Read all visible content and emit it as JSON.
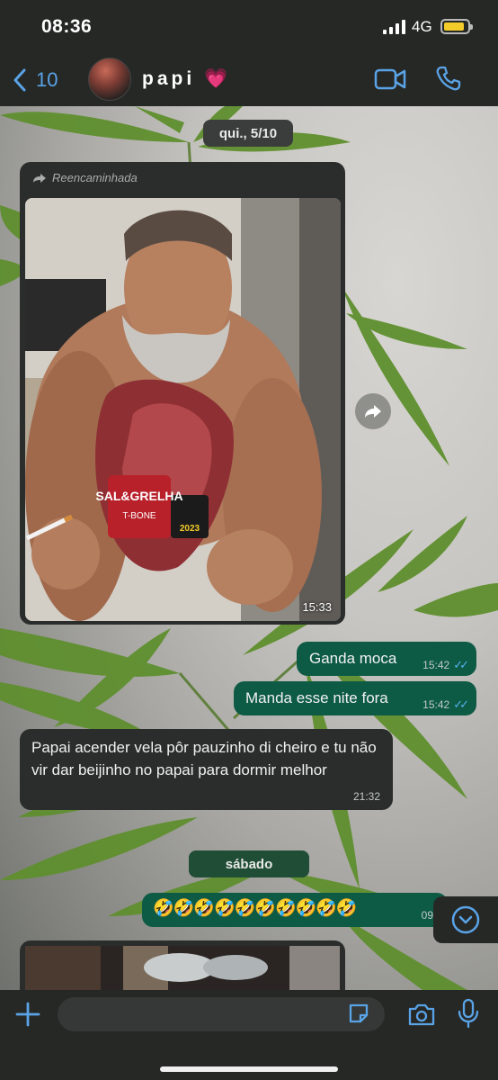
{
  "status": {
    "time": "08:36",
    "network": "4G"
  },
  "header": {
    "back_count": "10",
    "contact_name": "papi",
    "contact_emoji": "💗"
  },
  "dates": {
    "first": "qui., 5/10",
    "second": "sábado"
  },
  "messages": {
    "forwarded": {
      "label": "Reencaminhada",
      "time": "15:33",
      "photo_brand": "SAL&GRELHA",
      "photo_product": "T-BONE",
      "photo_year": "2023"
    },
    "out1": {
      "text": "Ganda moca",
      "time": "15:42"
    },
    "out2": {
      "text": "Manda esse nite fora",
      "time": "15:42"
    },
    "in1": {
      "text": "Papai acender vela pôr pauzinho di cheiro e tu não vir dar beijinho no papai para dormir melhor",
      "time": "21:32"
    },
    "out3": {
      "text": "🤣🤣🤣🤣🤣🤣🤣🤣🤣🤣",
      "time": "09"
    }
  },
  "icons": {
    "back": "chevron-left-icon",
    "video": "video-call-icon",
    "phone": "phone-icon",
    "forward": "forward-arrow-icon",
    "scroll": "scroll-down-icon",
    "plus": "plus-icon",
    "sticker": "sticker-icon",
    "camera": "camera-icon",
    "mic": "microphone-icon"
  },
  "colors": {
    "accent_blue": "#5aa3e6",
    "outgoing_bubble": "#0d5b45",
    "incoming_bubble": "#2a2d2c",
    "read_ticks": "#54b2f0",
    "battery": "#f4cc2a"
  }
}
